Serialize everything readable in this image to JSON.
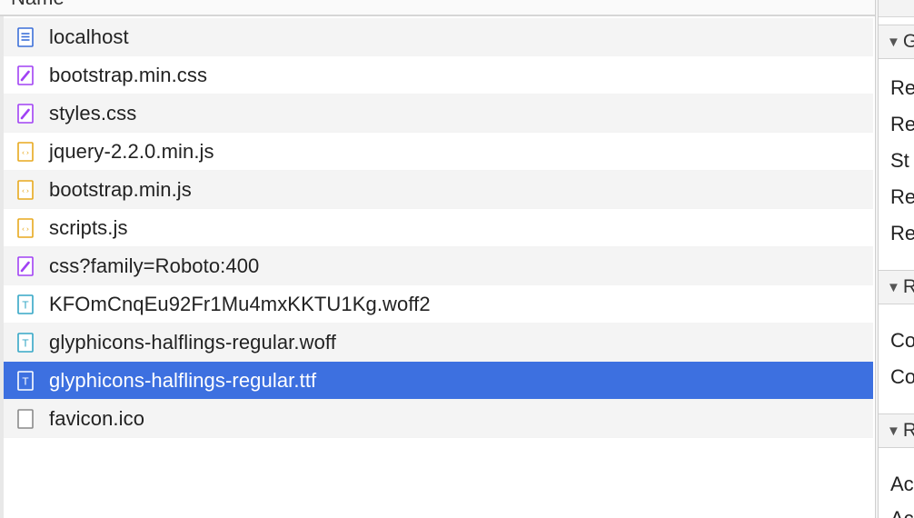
{
  "list": {
    "header_label": "Name",
    "rows": [
      {
        "name": "localhost",
        "icon": "document-icon",
        "type": "doc"
      },
      {
        "name": "bootstrap.min.css",
        "icon": "stylesheet-icon",
        "type": "css"
      },
      {
        "name": "styles.css",
        "icon": "stylesheet-icon",
        "type": "css"
      },
      {
        "name": "jquery-2.2.0.min.js",
        "icon": "script-icon",
        "type": "js"
      },
      {
        "name": "bootstrap.min.js",
        "icon": "script-icon",
        "type": "js"
      },
      {
        "name": "scripts.js",
        "icon": "script-icon",
        "type": "js"
      },
      {
        "name": "css?family=Roboto:400",
        "icon": "stylesheet-icon",
        "type": "css"
      },
      {
        "name": "KFOmCnqEu92Fr1Mu4mxKKTU1Kg.woff2",
        "icon": "font-icon",
        "type": "font"
      },
      {
        "name": "glyphicons-halflings-regular.woff",
        "icon": "font-icon",
        "type": "font"
      },
      {
        "name": "glyphicons-halflings-regular.ttf",
        "icon": "font-icon",
        "type": "font",
        "selected": true
      },
      {
        "name": "favicon.ico",
        "icon": "image-icon",
        "type": "other"
      }
    ]
  },
  "details": {
    "sections": [
      {
        "label": "G",
        "fields": [
          "Re",
          "Re",
          "St",
          "Re",
          "Re"
        ]
      },
      {
        "label": "R",
        "fields": [
          "Co",
          "Co"
        ]
      },
      {
        "label": "R",
        "fields": [
          "Ac",
          "Ac"
        ]
      }
    ]
  },
  "colors": {
    "selected_row": "#3d70e0",
    "doc_icon": "#3b6fd8",
    "css_icon": "#a142f4",
    "js_icon": "#e8a91e",
    "font_icon": "#35a7c6",
    "other_icon": "#8a8a8a"
  }
}
